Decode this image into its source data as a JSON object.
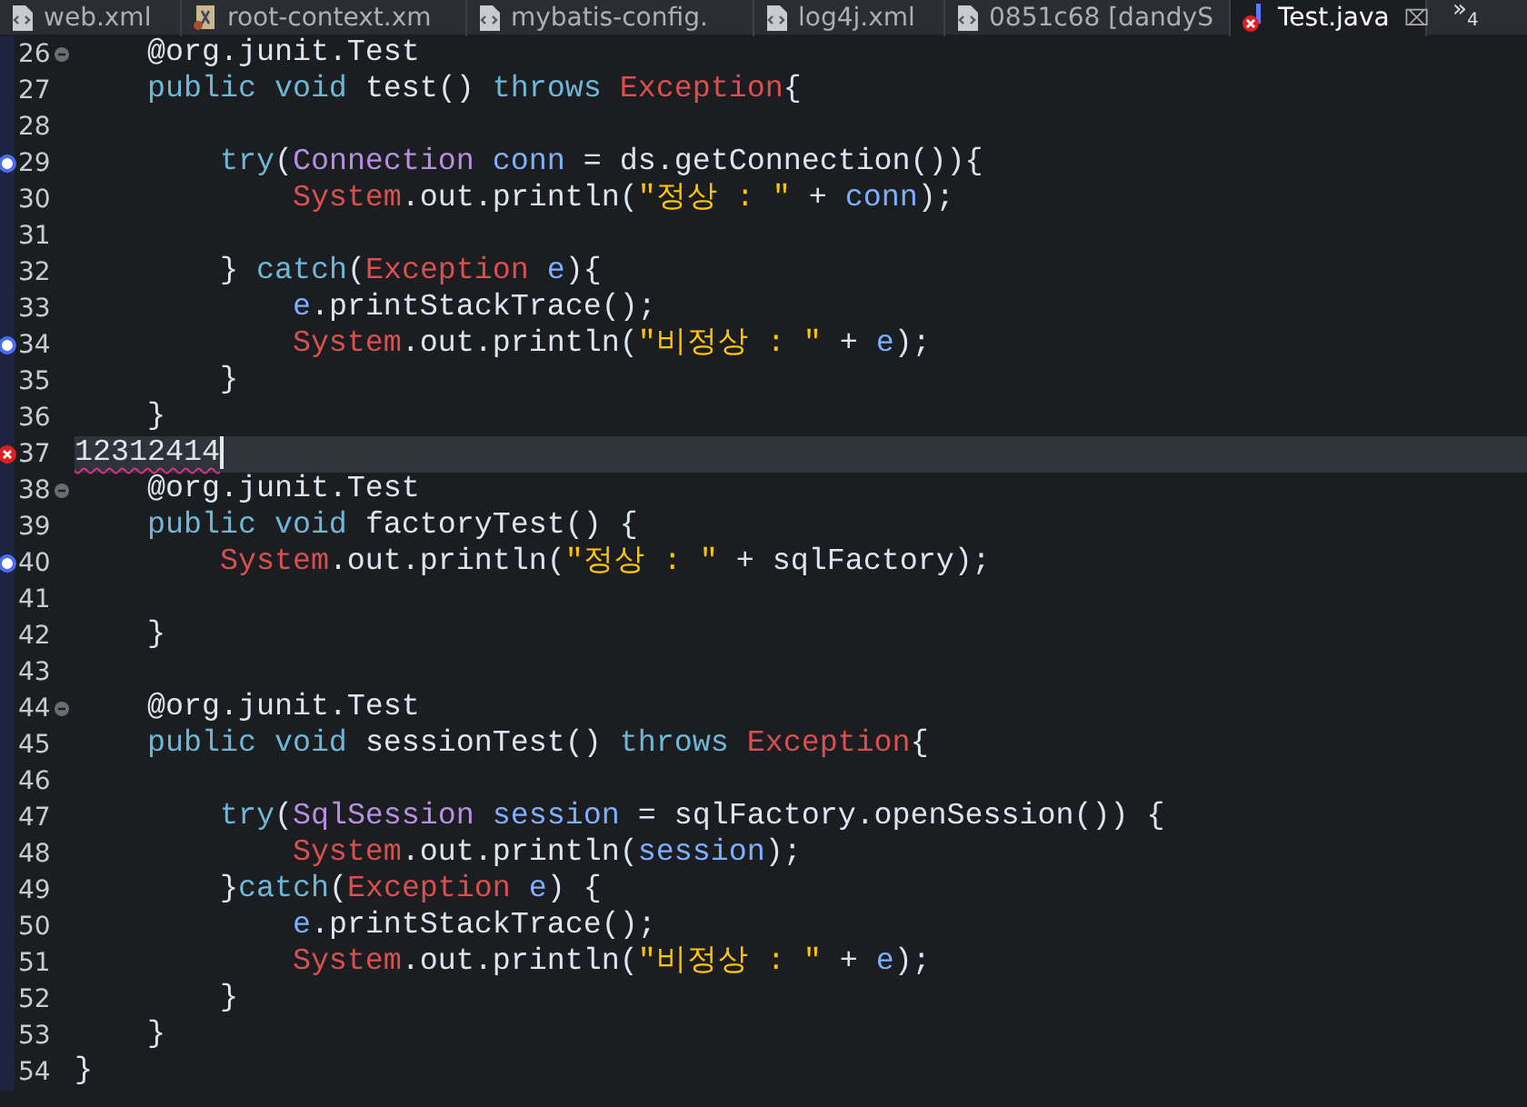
{
  "tabs": [
    {
      "label": "web.xml",
      "kind": "file",
      "selected": false
    },
    {
      "label": "root-context.xm",
      "kind": "xml",
      "selected": false
    },
    {
      "label": "mybatis-config.",
      "kind": "file",
      "selected": false
    },
    {
      "label": "log4j.xml",
      "kind": "file",
      "selected": false
    },
    {
      "label": "0851c68 [dandyS",
      "kind": "file",
      "selected": false
    },
    {
      "label": "Test.java",
      "kind": "java-error",
      "selected": true,
      "close": "⌧"
    }
  ],
  "overflow": {
    "chevron": "»",
    "count": "4"
  },
  "lines": [
    {
      "number": "26",
      "fold": true,
      "kind": "normal",
      "current": false,
      "tokens": [
        {
          "kind": "plain",
          "t": "    @org.junit.Test"
        }
      ]
    },
    {
      "number": "27",
      "fold": false,
      "kind": "normal",
      "current": false,
      "tokens": [
        {
          "kind": "kw",
          "t": "    public void "
        },
        {
          "kind": "plain",
          "t": "test() "
        },
        {
          "kind": "kw",
          "t": "throws "
        },
        {
          "kind": "cls",
          "t": "Exception"
        },
        {
          "kind": "plain",
          "t": "{"
        }
      ]
    },
    {
      "number": "28",
      "fold": false,
      "kind": "normal",
      "current": false
    },
    {
      "number": "29",
      "fold": false,
      "kind": "breakpoint",
      "current": false,
      "tokens": [
        {
          "kind": "kw",
          "t": "        try"
        },
        {
          "kind": "plain",
          "t": "("
        },
        {
          "kind": "type",
          "t": "Connection "
        },
        {
          "kind": "var",
          "t": "conn"
        },
        {
          "kind": "plain",
          "t": " = ds.getConnection()){"
        }
      ]
    },
    {
      "number": "30",
      "fold": false,
      "kind": "normal",
      "current": false,
      "tokens": [
        {
          "kind": "cls",
          "t": "            System"
        },
        {
          "kind": "plain",
          "t": ".out.println("
        },
        {
          "kind": "str",
          "t": "\"정상 : \""
        },
        {
          "kind": "plain",
          "t": " + "
        },
        {
          "kind": "var",
          "t": "conn"
        },
        {
          "kind": "plain",
          "t": ");"
        }
      ]
    },
    {
      "number": "31",
      "fold": false,
      "kind": "normal",
      "current": false
    },
    {
      "number": "32",
      "fold": false,
      "kind": "normal",
      "current": false,
      "tokens": [
        {
          "kind": "plain",
          "t": "        } "
        },
        {
          "kind": "kw",
          "t": "catch"
        },
        {
          "kind": "plain",
          "t": "("
        },
        {
          "kind": "cls",
          "t": "Exception"
        },
        {
          "kind": "var",
          "t": " e"
        },
        {
          "kind": "plain",
          "t": "){"
        }
      ]
    },
    {
      "number": "33",
      "fold": false,
      "kind": "normal",
      "current": false,
      "tokens": [
        {
          "kind": "var",
          "t": "            e"
        },
        {
          "kind": "plain",
          "t": ".printStackTrace();"
        }
      ]
    },
    {
      "number": "34",
      "fold": false,
      "kind": "breakpoint",
      "current": false,
      "tokens": [
        {
          "kind": "cls",
          "t": "            System"
        },
        {
          "kind": "plain",
          "t": ".out.println("
        },
        {
          "kind": "str",
          "t": "\"비정상 : \""
        },
        {
          "kind": "plain",
          "t": " + "
        },
        {
          "kind": "var",
          "t": "e"
        },
        {
          "kind": "plain",
          "t": ");"
        }
      ]
    },
    {
      "number": "35",
      "fold": false,
      "kind": "normal",
      "current": false,
      "tokens": [
        {
          "kind": "plain",
          "t": "        }"
        }
      ]
    },
    {
      "number": "36",
      "fold": false,
      "kind": "normal",
      "current": false,
      "tokens": [
        {
          "kind": "plain",
          "t": "    }"
        }
      ]
    },
    {
      "number": "37",
      "fold": false,
      "kind": "error",
      "current": true,
      "tokens": [
        {
          "kind": "plain",
          "t": "12312414"
        }
      ]
    },
    {
      "number": "38",
      "fold": true,
      "kind": "normal",
      "current": false,
      "tokens": [
        {
          "kind": "plain",
          "t": "    @org.junit.Test"
        }
      ]
    },
    {
      "number": "39",
      "fold": false,
      "kind": "normal",
      "current": false,
      "tokens": [
        {
          "kind": "kw",
          "t": "    public void "
        },
        {
          "kind": "plain",
          "t": "factoryTest() {"
        }
      ]
    },
    {
      "number": "40",
      "fold": false,
      "kind": "breakpoint",
      "current": false,
      "tokens": [
        {
          "kind": "cls",
          "t": "        System"
        },
        {
          "kind": "plain",
          "t": ".out.println("
        },
        {
          "kind": "str",
          "t": "\"정상 : \""
        },
        {
          "kind": "plain",
          "t": " + sqlFactory);"
        }
      ]
    },
    {
      "number": "41",
      "fold": false,
      "kind": "normal",
      "current": false
    },
    {
      "number": "42",
      "fold": false,
      "kind": "normal",
      "current": false,
      "tokens": [
        {
          "kind": "plain",
          "t": "    }"
        }
      ]
    },
    {
      "number": "43",
      "fold": false,
      "kind": "normal",
      "current": false
    },
    {
      "number": "44",
      "fold": true,
      "kind": "normal",
      "current": false,
      "tokens": [
        {
          "kind": "plain",
          "t": "    @org.junit.Test"
        }
      ]
    },
    {
      "number": "45",
      "fold": false,
      "kind": "normal",
      "current": false,
      "tokens": [
        {
          "kind": "kw",
          "t": "    public void "
        },
        {
          "kind": "plain",
          "t": "sessionTest() "
        },
        {
          "kind": "kw",
          "t": "throws "
        },
        {
          "kind": "cls",
          "t": "Exception"
        },
        {
          "kind": "plain",
          "t": "{"
        }
      ]
    },
    {
      "number": "46",
      "fold": false,
      "kind": "normal",
      "current": false
    },
    {
      "number": "47",
      "fold": false,
      "kind": "normal",
      "current": false,
      "tokens": [
        {
          "kind": "kw",
          "t": "        try"
        },
        {
          "kind": "plain",
          "t": "("
        },
        {
          "kind": "type",
          "t": "SqlSession "
        },
        {
          "kind": "var",
          "t": "session"
        },
        {
          "kind": "plain",
          "t": " = sqlFactory.openSession()) {"
        }
      ]
    },
    {
      "number": "48",
      "fold": false,
      "kind": "normal",
      "current": false,
      "tokens": [
        {
          "kind": "cls",
          "t": "            System"
        },
        {
          "kind": "plain",
          "t": ".out.println("
        },
        {
          "kind": "var",
          "t": "session"
        },
        {
          "kind": "plain",
          "t": ");"
        }
      ]
    },
    {
      "number": "49",
      "fold": false,
      "kind": "normal",
      "current": false,
      "tokens": [
        {
          "kind": "plain",
          "t": "        }"
        },
        {
          "kind": "kw",
          "t": "catch"
        },
        {
          "kind": "plain",
          "t": "("
        },
        {
          "kind": "cls",
          "t": "Exception"
        },
        {
          "kind": "var",
          "t": " e"
        },
        {
          "kind": "plain",
          "t": ") {"
        }
      ]
    },
    {
      "number": "50",
      "fold": false,
      "kind": "normal",
      "current": false,
      "tokens": [
        {
          "kind": "var",
          "t": "            e"
        },
        {
          "kind": "plain",
          "t": ".printStackTrace();"
        }
      ]
    },
    {
      "number": "51",
      "fold": false,
      "kind": "normal",
      "current": false,
      "tokens": [
        {
          "kind": "cls",
          "t": "            System"
        },
        {
          "kind": "plain",
          "t": ".out.println("
        },
        {
          "kind": "str",
          "t": "\"비정상 : \""
        },
        {
          "kind": "plain",
          "t": " + "
        },
        {
          "kind": "var",
          "t": "e"
        },
        {
          "kind": "plain",
          "t": ");"
        }
      ]
    },
    {
      "number": "52",
      "fold": false,
      "kind": "normal",
      "current": false,
      "tokens": [
        {
          "kind": "plain",
          "t": "        }"
        }
      ]
    },
    {
      "number": "53",
      "fold": false,
      "kind": "normal",
      "current": false,
      "tokens": [
        {
          "kind": "plain",
          "t": "    }"
        }
      ]
    },
    {
      "number": "54",
      "fold": false,
      "kind": "normal",
      "current": false,
      "tokens": [
        {
          "kind": "plain",
          "t": "}"
        }
      ]
    }
  ]
}
